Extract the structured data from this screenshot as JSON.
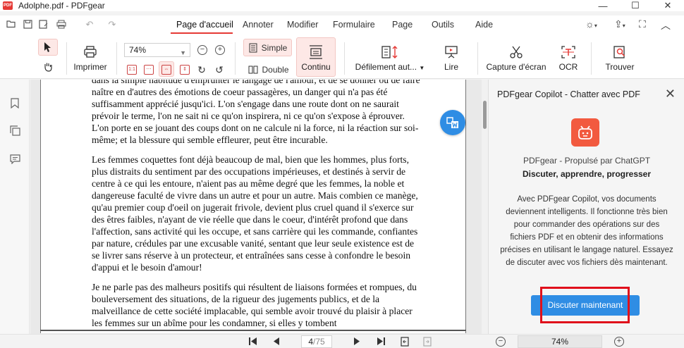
{
  "window": {
    "title": "Adolphe.pdf - PDFgear",
    "logo_text": "PDF",
    "minimize": "—",
    "maximize": "☐",
    "close": "✕"
  },
  "menu": {
    "tabs": [
      {
        "label": "Page d'accueil"
      },
      {
        "label": "Annoter"
      },
      {
        "label": "Modifier"
      },
      {
        "label": "Formulaire"
      },
      {
        "label": "Page"
      },
      {
        "label": "Outils"
      },
      {
        "label": "Aide"
      }
    ],
    "active_tab": "Page d'accueil"
  },
  "toolbar": {
    "print_label": "Imprimer",
    "zoom_value": "74%",
    "simple_label": "Simple",
    "double_label": "Double",
    "continu_label": "Continu",
    "scroll_label": "Défilement aut...",
    "read_label": "Lire",
    "capture_label": "Capture d'écran",
    "ocr_label": "OCR",
    "find_label": "Trouver"
  },
  "document": {
    "paragraphs": [
      "dans la simple habitude d'emprunter le langage de l'amour, et de se donner ou de faire naître en d'autres des émotions de coeur passagères, un danger qui n'a pas été suffisamment apprécié jusqu'ici. L'on s'engage dans une route dont on ne saurait prévoir le terme, l'on ne sait ni ce qu'on inspirera, ni ce qu'on s'expose à éprouver. L'on porte en se jouant des coups dont on ne calcule ni la force, ni la réaction sur soi-même; et la blessure qui semble effleurer, peut être incurable.",
      "Les femmes coquettes font déjà beaucoup de mal, bien que les hommes, plus forts, plus distraits du sentiment par des occupations impérieuses, et destinés à servir de centre à ce qui les entoure, n'aient pas au même degré que les femmes, la noble et dangereuse faculté de vivre dans un autre et pour un autre. Mais combien ce manège, qu'au premier coup d'oeil on jugerait frivole, devient plus cruel quand il s'exerce sur des êtres faibles, n'ayant de vie réelle que dans le coeur, d'intérêt profond que dans l'affection, sans activité qui les occupe, et sans carrière qui les commande, confiantes par nature, crédules par une excusable vanité, sentant que leur seule existence est de se livrer sans réserve à un protecteur, et entraînées sans cesse à confondre le besoin d'appui et le besoin d'amour!",
      "Je ne parle pas des malheurs positifs qui résultent de liaisons formées et rompues, du bouleversement des situations, de la rigueur des jugements publics, et de la malveillance de cette société implacable, qui semble avoir trouvé du plaisir à placer les femmes sur un abîme pour les condamner, si elles y tombent"
    ],
    "fab_icon": "word-convert-icon"
  },
  "copilot": {
    "title": "PDFgear Copilot - Chatter avec PDF",
    "subtitle": "PDFgear - Propulsé par ChatGPT",
    "tagline": "Discuter, apprendre, progresser",
    "description": "Avec PDFgear Copilot, vos documents deviennent intelligents.  Il fonctionne très bien pour commander des opérations sur des fichiers PDF et en obtenir des informations précises en utilisant le langage naturel.  Essayez de discuter avec vos fichiers dès maintenant.",
    "cta": "Discuter maintenant",
    "accent": "#2f8de4",
    "highlight": "#e0101b"
  },
  "statusbar": {
    "current_page": "4",
    "total_pages": "/75",
    "zoom": "74%"
  },
  "colors": {
    "brand": "#e53935",
    "active_tool_bg": "#fde8e6"
  }
}
